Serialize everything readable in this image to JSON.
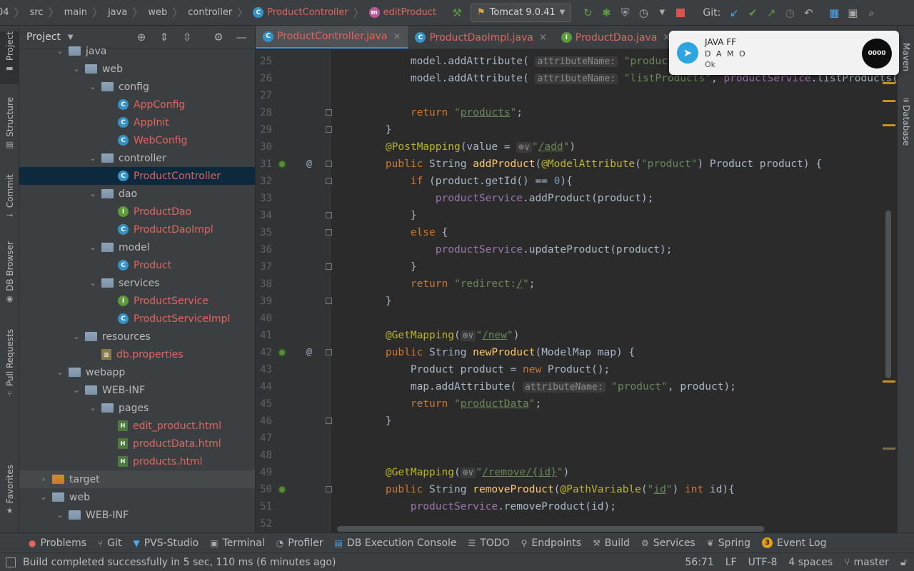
{
  "breadcrumb": {
    "items": [
      "04",
      "src",
      "main",
      "java",
      "web",
      "controller"
    ],
    "class_item": "ProductController",
    "method_item": "editProduct"
  },
  "toolbar": {
    "run_config": "Tomcat 9.0.41",
    "git_label": "Git:"
  },
  "left_tools": [
    "Project",
    "Structure",
    "Commit",
    "DB Browser",
    "Pull Requests",
    "Favorites"
  ],
  "right_tools": [
    "Maven",
    "Database"
  ],
  "project_panel": {
    "title": "Project",
    "tree": [
      {
        "label": "java",
        "type": "folder",
        "indent": 1,
        "chev": "open",
        "color": "normal"
      },
      {
        "label": "web",
        "type": "folder",
        "indent": 2,
        "chev": "open",
        "color": "normal"
      },
      {
        "label": "config",
        "type": "folder",
        "indent": 3,
        "chev": "open",
        "color": "normal"
      },
      {
        "label": "AppConfig",
        "type": "class",
        "indent": 4,
        "chev": "none",
        "color": "red"
      },
      {
        "label": "AppInit",
        "type": "class",
        "indent": 4,
        "chev": "none",
        "color": "red"
      },
      {
        "label": "WebConfig",
        "type": "class",
        "indent": 4,
        "chev": "none",
        "color": "red"
      },
      {
        "label": "controller",
        "type": "folder",
        "indent": 3,
        "chev": "open",
        "color": "normal"
      },
      {
        "label": "ProductController",
        "type": "class",
        "indent": 4,
        "chev": "none",
        "color": "red",
        "selected": true
      },
      {
        "label": "dao",
        "type": "folder",
        "indent": 3,
        "chev": "open",
        "color": "normal"
      },
      {
        "label": "ProductDao",
        "type": "iface",
        "indent": 4,
        "chev": "none",
        "color": "red"
      },
      {
        "label": "ProductDaoImpl",
        "type": "class",
        "indent": 4,
        "chev": "none",
        "color": "red"
      },
      {
        "label": "model",
        "type": "folder",
        "indent": 3,
        "chev": "open",
        "color": "normal"
      },
      {
        "label": "Product",
        "type": "class",
        "indent": 4,
        "chev": "none",
        "color": "red"
      },
      {
        "label": "services",
        "type": "folder",
        "indent": 3,
        "chev": "open",
        "color": "normal"
      },
      {
        "label": "ProductService",
        "type": "iface",
        "indent": 4,
        "chev": "none",
        "color": "red"
      },
      {
        "label": "ProductServiceImpl",
        "type": "class",
        "indent": 4,
        "chev": "none",
        "color": "red"
      },
      {
        "label": "resources",
        "type": "folder",
        "indent": 2,
        "chev": "open",
        "color": "normal"
      },
      {
        "label": "db.properties",
        "type": "props",
        "indent": 3,
        "chev": "none",
        "color": "red"
      },
      {
        "label": "webapp",
        "type": "folder",
        "indent": 1,
        "chev": "open",
        "color": "normal"
      },
      {
        "label": "WEB-INF",
        "type": "folder",
        "indent": 2,
        "chev": "open",
        "color": "normal"
      },
      {
        "label": "pages",
        "type": "folder",
        "indent": 3,
        "chev": "open",
        "color": "normal"
      },
      {
        "label": "edit_product.html",
        "type": "html",
        "indent": 4,
        "chev": "none",
        "color": "red"
      },
      {
        "label": "productData.html",
        "type": "html",
        "indent": 4,
        "chev": "none",
        "color": "red"
      },
      {
        "label": "products.html",
        "type": "html",
        "indent": 4,
        "chev": "none",
        "color": "red"
      },
      {
        "label": "target",
        "type": "folder-orange",
        "indent": 0,
        "chev": "closed",
        "color": "normal",
        "dim": true
      },
      {
        "label": "web",
        "type": "folder",
        "indent": 0,
        "chev": "open",
        "color": "normal"
      },
      {
        "label": "WEB-INF",
        "type": "folder",
        "indent": 1,
        "chev": "open",
        "color": "normal"
      }
    ]
  },
  "editor_tabs": [
    {
      "label": "ProductController.java",
      "badge": "C",
      "active": true
    },
    {
      "label": "ProductDaoImpl.java",
      "badge": "C",
      "active": false
    },
    {
      "label": "ProductDao.java",
      "badge": "I",
      "active": false
    }
  ],
  "code_lines": [
    {
      "n": "25",
      "html": "        model.addAttribute( <span class=\"hint\">attributeName:</span> <span class=\"st\">\"product\"</span>, <span class=\"kw\">ne</span>"
    },
    {
      "n": "26",
      "html": "        model.addAttribute( <span class=\"hint\">attributeName:</span> <span class=\"st\">\"listProducts\"</span>, <span class=\"fld\">productService</span>.listProducts());"
    },
    {
      "n": "27",
      "html": ""
    },
    {
      "n": "28",
      "html": "        <span class=\"kw\">return</span> <span class=\"st\">\"<span class=\"ul\">products</span>\"</span>;",
      "fold": true
    },
    {
      "n": "29",
      "html": "    }",
      "fold": true
    },
    {
      "n": "30",
      "html": "    <span class=\"an\">@PostMapping</span>(value = <span class=\"hint\">⊕∨</span><span class=\"st\">\"<span class=\"ul\">/add</span>\"</span>)"
    },
    {
      "n": "31",
      "html": "    <span class=\"kw\">public</span> String <span class=\"fn\">addProduct</span>(<span class=\"an\">@ModelAttribute</span>(<span class=\"st\">\"product\"</span>) Product product) {",
      "bean": true,
      "at": true,
      "fold": true
    },
    {
      "n": "32",
      "html": "        <span class=\"kw\">if</span> (product.getId() == <span class=\"num\">0</span>){",
      "fold": true
    },
    {
      "n": "33",
      "html": "            <span class=\"fld\">productService</span>.addProduct(product);"
    },
    {
      "n": "34",
      "html": "        }",
      "fold": true
    },
    {
      "n": "35",
      "html": "        <span class=\"kw\">else</span> {",
      "fold": true
    },
    {
      "n": "36",
      "html": "            <span class=\"fld\">productService</span>.updateProduct(product);"
    },
    {
      "n": "37",
      "html": "        }",
      "fold": true
    },
    {
      "n": "38",
      "html": "        <span class=\"kw\">return</span> <span class=\"st\">\"redirect:<span class=\"ul\">/</span>\"</span>;"
    },
    {
      "n": "39",
      "html": "    }",
      "fold": true
    },
    {
      "n": "40",
      "html": ""
    },
    {
      "n": "41",
      "html": "    <span class=\"an\">@GetMapping</span>(<span class=\"hint\">⊕∨</span><span class=\"st\">\"<span class=\"ul\">/new</span>\"</span>)"
    },
    {
      "n": "42",
      "html": "    <span class=\"kw\">public</span> String <span class=\"fn\">newProduct</span>(ModelMap map) {",
      "bean": true,
      "at": true,
      "fold": true
    },
    {
      "n": "43",
      "html": "        Product product = <span class=\"kw\">new</span> Product();"
    },
    {
      "n": "44",
      "html": "        map.addAttribute( <span class=\"hint\">attributeName:</span> <span class=\"st\">\"product\"</span>, product);"
    },
    {
      "n": "45",
      "html": "        <span class=\"kw\">return</span> <span class=\"st\">\"<span class=\"ul\">productData</span>\"</span>;"
    },
    {
      "n": "46",
      "html": "    }",
      "fold": true
    },
    {
      "n": "47",
      "html": ""
    },
    {
      "n": "48",
      "html": ""
    },
    {
      "n": "49",
      "html": "    <span class=\"an\">@GetMapping</span>(<span class=\"hint\">⊕∨</span><span class=\"st\">\"<span class=\"ul\">/remove/{id}</span>\"</span>)"
    },
    {
      "n": "50",
      "html": "    <span class=\"kw\">public</span> String <span class=\"fn\">removeProduct</span>(<span class=\"an\">@PathVariable</span>(<span class=\"st\">\"<span class=\"ul\">id</span>\"</span>) <span class=\"kw\">int</span> id){",
      "bean": true,
      "fold": true
    },
    {
      "n": "51",
      "html": "        <span class=\"fld\">productService</span>.removeProduct(id);"
    },
    {
      "n": "52",
      "html": ""
    }
  ],
  "notification": {
    "title": "JAVA FF",
    "subtitle": "D A M O",
    "message": "Ok",
    "avatar_text": "0000"
  },
  "bottom_tools": [
    {
      "label": "Problems",
      "icon": "●",
      "style": "red"
    },
    {
      "label": "Git",
      "icon": "⑂",
      "style": ""
    },
    {
      "label": "PVS-Studio",
      "icon": "▼",
      "style": "blue"
    },
    {
      "label": "Terminal",
      "icon": "▣",
      "style": ""
    },
    {
      "label": "Profiler",
      "icon": "◔",
      "style": ""
    },
    {
      "label": "DB Execution Console",
      "icon": "▤",
      "style": "blue"
    },
    {
      "label": "TODO",
      "icon": "☰",
      "style": ""
    },
    {
      "label": "Endpoints",
      "icon": "⚲",
      "style": ""
    },
    {
      "label": "Build",
      "icon": "⚒",
      "style": ""
    },
    {
      "label": "Services",
      "icon": "⚙",
      "style": ""
    },
    {
      "label": "Spring",
      "icon": "❦",
      "style": ""
    },
    {
      "label": "Event Log",
      "icon": "3",
      "style": "badge"
    }
  ],
  "status": {
    "message": "Build completed successfully in 5 sec, 110 ms (6 minutes ago)",
    "position": "56:71",
    "line_sep": "LF",
    "encoding": "UTF-8",
    "indent": "4 spaces",
    "branch": "master"
  },
  "colors": {
    "bg": "#2b2b2b",
    "panel": "#3c3f41",
    "accent": "#4a88c7",
    "modified": "#e0655f",
    "marker": "#c8901f"
  }
}
